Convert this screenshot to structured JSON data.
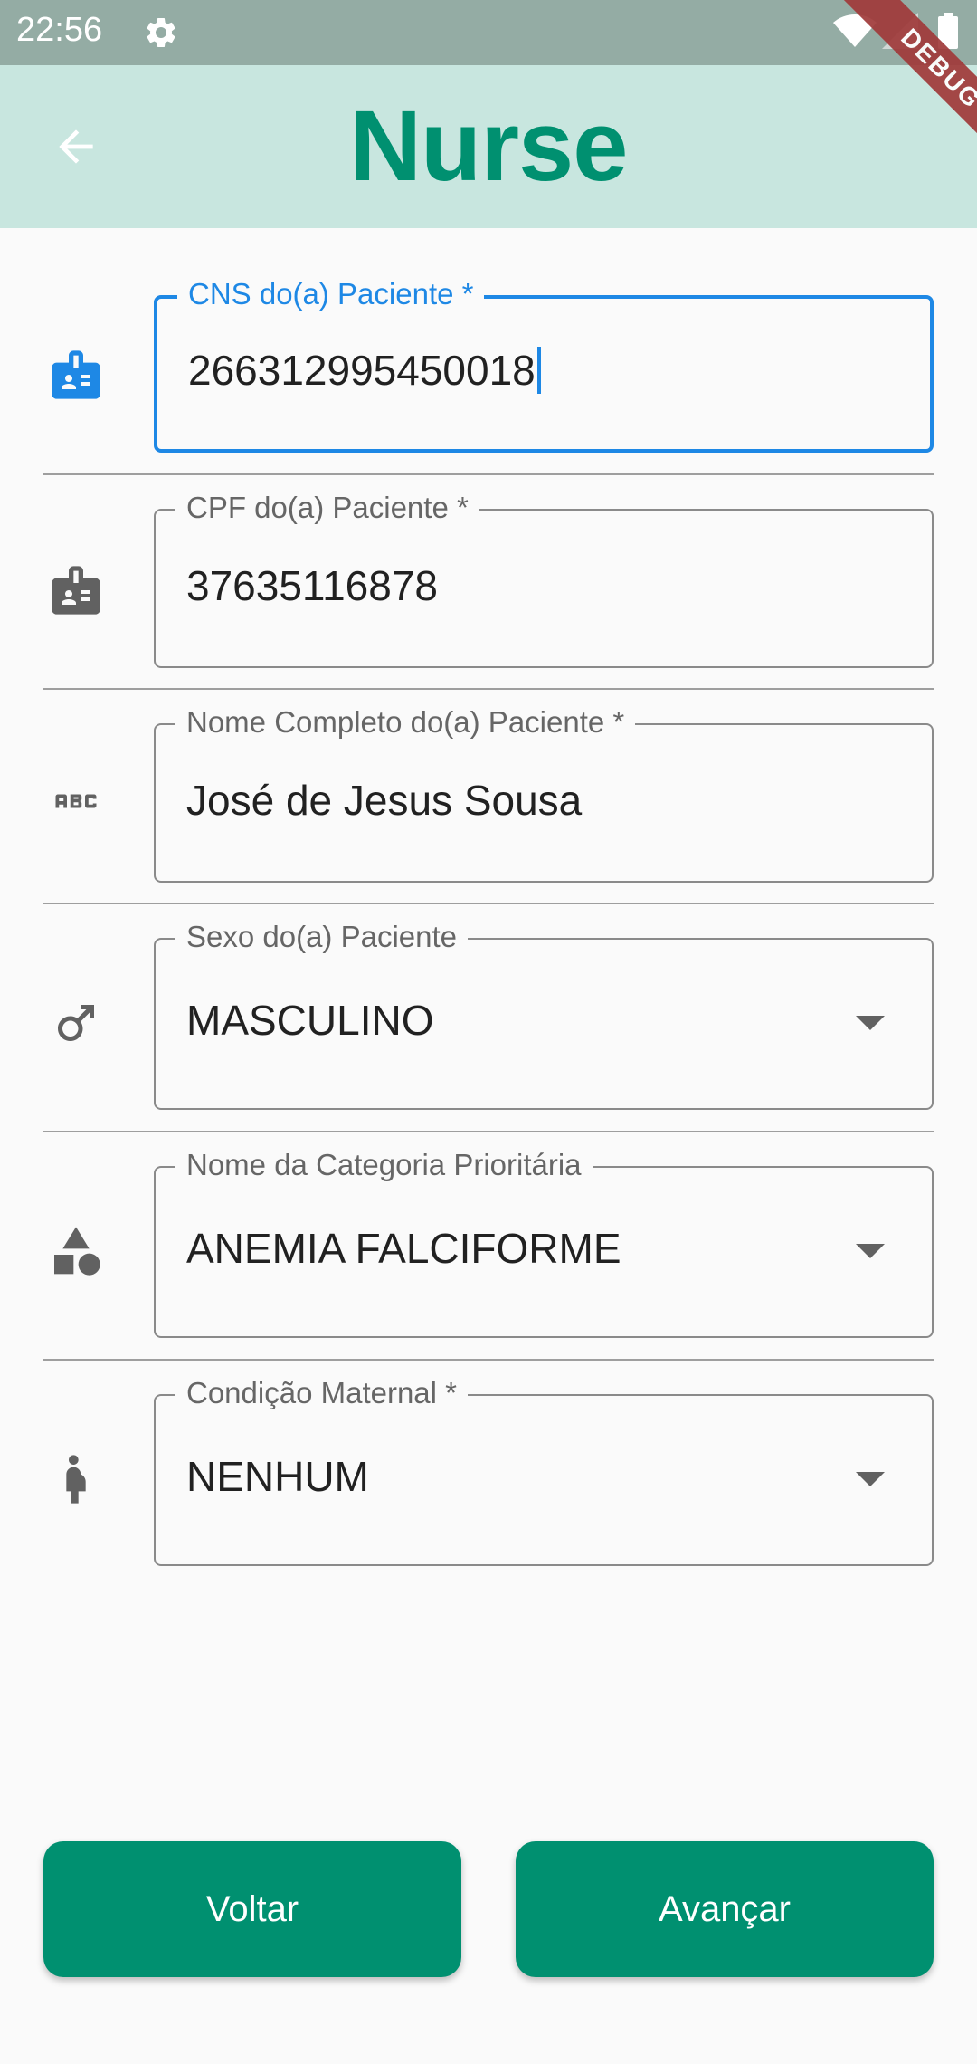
{
  "status_bar": {
    "time": "22:56"
  },
  "app_bar": {
    "title": "Nurse",
    "debug_label": "DEBUG"
  },
  "form": {
    "cns": {
      "label": "CNS do(a) Paciente *",
      "value": "266312995450018"
    },
    "cpf": {
      "label": "CPF do(a) Paciente *",
      "value": "37635116878"
    },
    "name": {
      "label": "Nome Completo do(a) Paciente *",
      "value": "José de Jesus Sousa"
    },
    "sex": {
      "label": "Sexo do(a) Paciente",
      "value": "MASCULINO"
    },
    "category": {
      "label": "Nome da Categoria Prioritária",
      "value": "ANEMIA FALCIFORME"
    },
    "maternal": {
      "label": "Condição Maternal *",
      "value": "NENHUM"
    }
  },
  "buttons": {
    "back": "Voltar",
    "next": "Avançar"
  },
  "colors": {
    "primary": "#009070",
    "app_bar_bg": "#c8e6df",
    "focus": "#1e88e5",
    "status_bar_bg": "#94aca4"
  },
  "icons": {
    "cns": "badge-icon",
    "cpf": "badge-icon",
    "name": "abc-icon",
    "sex": "male-icon",
    "category": "category-icon",
    "maternal": "pregnant-woman-icon"
  }
}
